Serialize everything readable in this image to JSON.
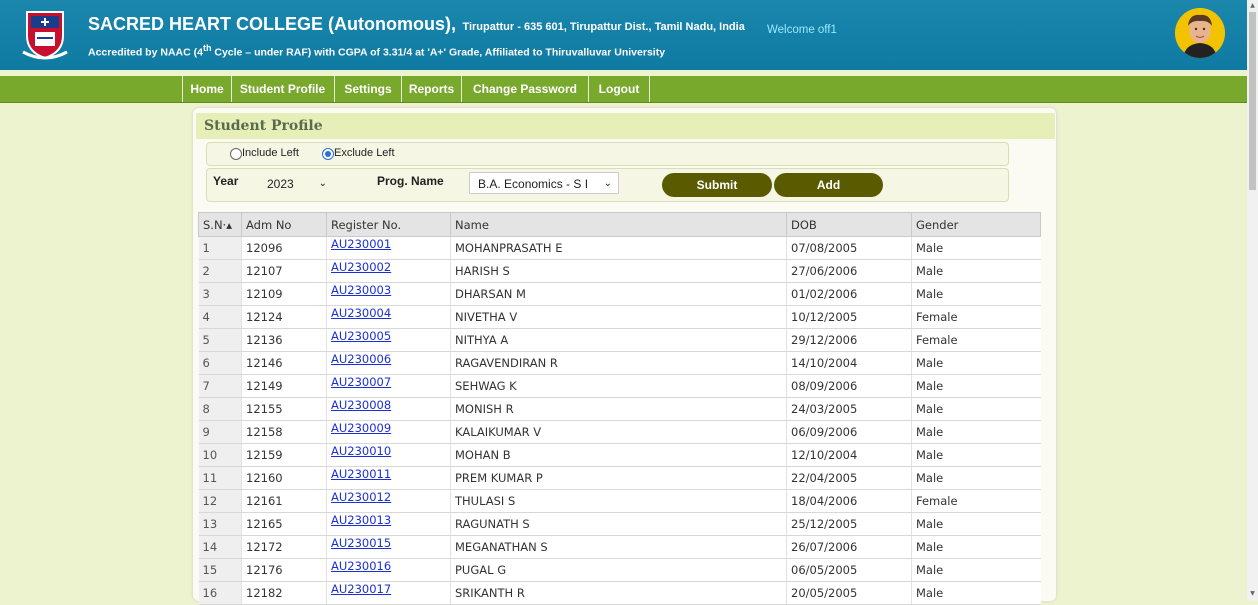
{
  "header": {
    "college_name": "SACRED HEART COLLEGE (Autonomous),",
    "address": "Tirupattur - 635 601, Tirupattur Dist., Tamil Nadu, India",
    "accreditation_prefix": "Accredited by NAAC (4",
    "accreditation_sup": "th",
    "accreditation_suffix": " Cycle – under RAF) with CGPA of 3.31/4 at 'A+' Grade, Affiliated to Thiruvalluvar University",
    "welcome": "Welcome  off1"
  },
  "nav": [
    "Home",
    "Student Profile",
    "Settings",
    "Reports",
    "Change Password",
    "Logout"
  ],
  "panel": {
    "title": "Student Profile",
    "include_left_label": "Include Left",
    "exclude_left_label": "Exclude Left",
    "selected_filter": "Exclude Left",
    "year_label": "Year",
    "year_value": "2023",
    "prog_label": "Prog. Name",
    "prog_value": "B.A. Economics - S I",
    "submit_label": "Submit",
    "add_label": "Add"
  },
  "table": {
    "headers": [
      "S.N·▴",
      "Adm No",
      "Register No.",
      "Name",
      "DOB",
      "Gender"
    ],
    "rows": [
      [
        "1",
        "12096",
        "AU230001",
        "MOHANPRASATH E",
        "07/08/2005",
        "Male"
      ],
      [
        "2",
        "12107",
        "AU230002",
        "HARISH S",
        "27/06/2006",
        "Male"
      ],
      [
        "3",
        "12109",
        "AU230003",
        "DHARSAN M",
        "01/02/2006",
        "Male"
      ],
      [
        "4",
        "12124",
        "AU230004",
        "NIVETHA V",
        "10/12/2005",
        "Female"
      ],
      [
        "5",
        "12136",
        "AU230005",
        "NITHYA A",
        "29/12/2006",
        "Female"
      ],
      [
        "6",
        "12146",
        "AU230006",
        "RAGAVENDIRAN R",
        "14/10/2004",
        "Male"
      ],
      [
        "7",
        "12149",
        "AU230007",
        "SEHWAG K",
        "08/09/2006",
        "Male"
      ],
      [
        "8",
        "12155",
        "AU230008",
        "MONISH R",
        "24/03/2005",
        "Male"
      ],
      [
        "9",
        "12158",
        "AU230009",
        "KALAIKUMAR V",
        "06/09/2006",
        "Male"
      ],
      [
        "10",
        "12159",
        "AU230010",
        "MOHAN B",
        "12/10/2004",
        "Male"
      ],
      [
        "11",
        "12160",
        "AU230011",
        "PREM KUMAR P",
        "22/04/2005",
        "Male"
      ],
      [
        "12",
        "12161",
        "AU230012",
        "THULASI S",
        "18/04/2006",
        "Female"
      ],
      [
        "13",
        "12165",
        "AU230013",
        "RAGUNATH S",
        "25/12/2005",
        "Male"
      ],
      [
        "14",
        "12172",
        "AU230015",
        "MEGANATHAN S",
        "26/07/2006",
        "Male"
      ],
      [
        "15",
        "12176",
        "AU230016",
        "PUGAL G",
        "06/05/2005",
        "Male"
      ],
      [
        "16",
        "12182",
        "AU230017",
        "SRIKANTH R",
        "20/05/2005",
        "Male"
      ]
    ]
  },
  "colors": {
    "header_bg": "#1583ab",
    "nav_bg": "#78a82c",
    "page_bg": "#eef3cf",
    "button_bg": "#5a5a00",
    "link": "#1a2fd6"
  }
}
